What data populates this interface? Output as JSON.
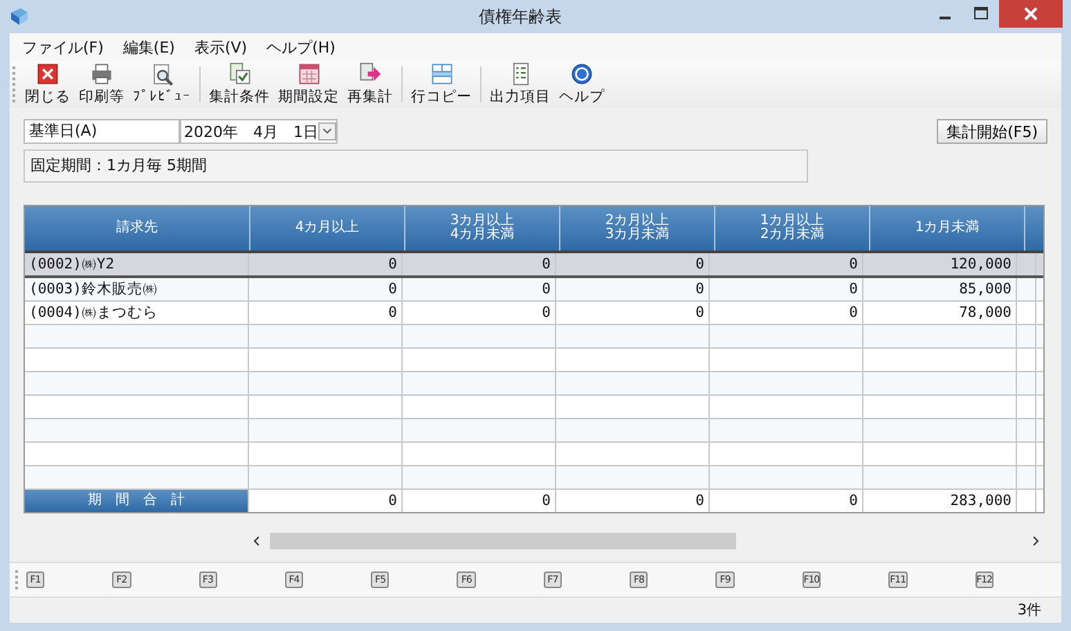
{
  "window": {
    "title": "債権年齢表"
  },
  "menu": [
    "ファイル(F)",
    "編集(E)",
    "表示(V)",
    "ヘルプ(H)"
  ],
  "toolbar": [
    {
      "label": "閉じる",
      "kind": "close"
    },
    {
      "label": "印刷等",
      "kind": "print"
    },
    {
      "label": "ﾌﾟﾚﾋﾞｭｰ",
      "kind": "preview"
    },
    {
      "label": "集計条件",
      "kind": "conditions"
    },
    {
      "label": "期間設定",
      "kind": "calendar"
    },
    {
      "label": "再集計",
      "kind": "recalc"
    },
    {
      "label": "行コピー",
      "kind": "rowcopy"
    },
    {
      "label": "出力項目",
      "kind": "output"
    },
    {
      "label": "ヘルプ",
      "kind": "help"
    }
  ],
  "date_label": "基準日(A)",
  "date_value": "2020年　4月　1日",
  "start_button": "集計開始(F5)",
  "period_info": "固定期間：1カ月毎 5期間",
  "table": {
    "columns": [
      "請求先",
      "4カ月以上",
      "3カ月以上\n4カ月未満",
      "2カ月以上\n3カ月未満",
      "1カ月以上\n2カ月未満",
      "1カ月未満"
    ],
    "rows": [
      {
        "cells": [
          "(0002)㈱Y2",
          "0",
          "0",
          "0",
          "0",
          "120,000"
        ],
        "selected": true
      },
      {
        "cells": [
          "(0003)鈴木販売㈱",
          "0",
          "0",
          "0",
          "0",
          "85,000"
        ],
        "selected": false
      },
      {
        "cells": [
          "(0004)㈱まつむら",
          "0",
          "0",
          "0",
          "0",
          "78,000"
        ],
        "selected": false
      }
    ],
    "total": {
      "label": "期　間　合　計",
      "cells": [
        "0",
        "0",
        "0",
        "0",
        "283,000"
      ]
    }
  },
  "function_keys": [
    "F1",
    "F2",
    "F3",
    "F4",
    "F5",
    "F6",
    "F7",
    "F8",
    "F9",
    "F10",
    "F11",
    "F12"
  ],
  "status_bar": "3件"
}
